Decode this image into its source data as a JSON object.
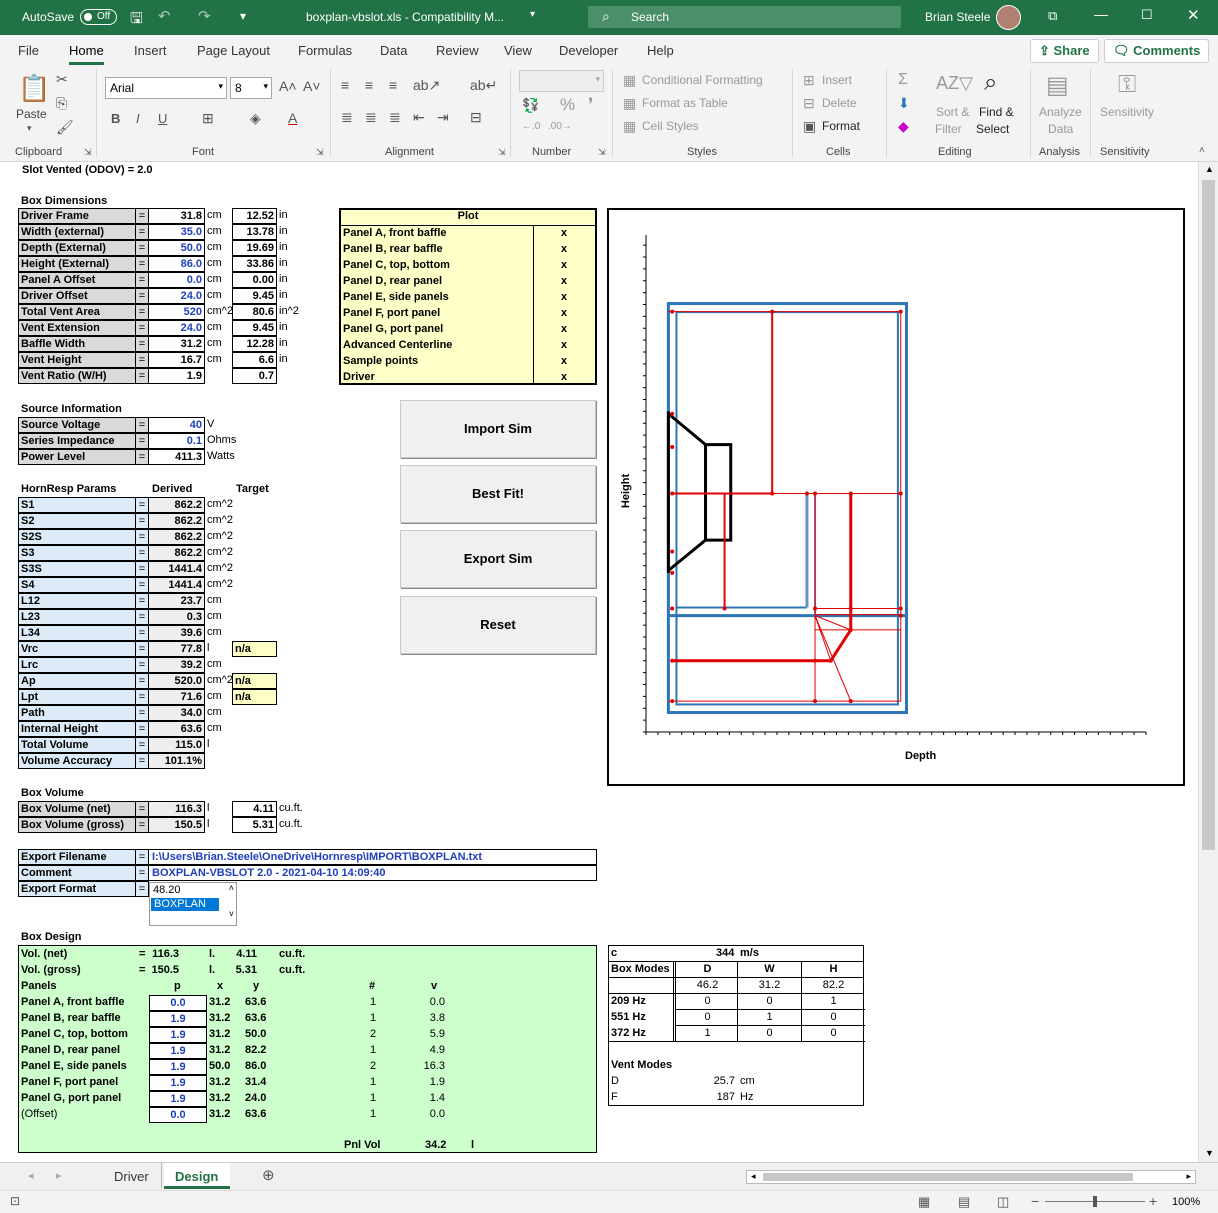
{
  "titlebar": {
    "autosave": "AutoSave",
    "toggle": "Off",
    "filename": "boxplan-vbslot.xls  -  Compatibility M...",
    "search": "Search",
    "user": "Brian Steele"
  },
  "tabs": [
    "File",
    "Home",
    "Insert",
    "Page Layout",
    "Formulas",
    "Data",
    "Review",
    "View",
    "Developer",
    "Help"
  ],
  "share": "Share",
  "comments": "Comments",
  "ribbon": {
    "paste": "Paste",
    "clipboard": "Clipboard",
    "font_name": "Arial",
    "font_size": "8",
    "font": "Font",
    "alignment": "Alignment",
    "number": "Number",
    "cond_format": "Conditional Formatting",
    "format_table": "Format as Table",
    "cell_styles": "Cell Styles",
    "styles": "Styles",
    "insert": "Insert",
    "delete": "Delete",
    "format": "Format",
    "cells": "Cells",
    "sort_filter_1": "Sort &",
    "sort_filter_2": "Filter",
    "find_select_1": "Find &",
    "find_select_2": "Select",
    "editing": "Editing",
    "analyze_1": "Analyze",
    "analyze_2": "Data",
    "analysis": "Analysis",
    "sensitivity": "Sensitivity",
    "sensitivity_grp": "Sensitivity"
  },
  "slot_vented": "Slot Vented (ODOV)   =  2.0",
  "box_dimensions": {
    "title": "Box Dimensions",
    "rows": [
      {
        "label": "Driver Frame",
        "v": "31.8",
        "u": "cm",
        "v2": "12.52",
        "u2": "in",
        "blue": false
      },
      {
        "label": "Width (external)",
        "v": "35.0",
        "u": "cm",
        "v2": "13.78",
        "u2": "in",
        "blue": true
      },
      {
        "label": "Depth (External)",
        "v": "50.0",
        "u": "cm",
        "v2": "19.69",
        "u2": "in",
        "blue": true
      },
      {
        "label": "Height (External)",
        "v": "86.0",
        "u": "cm",
        "v2": "33.86",
        "u2": "in",
        "blue": true
      },
      {
        "label": "Panel A Offset",
        "v": "0.0",
        "u": "cm",
        "v2": "0.00",
        "u2": "in",
        "blue": true
      },
      {
        "label": "Driver Offset",
        "v": "24.0",
        "u": "cm",
        "v2": "9.45",
        "u2": "in",
        "blue": true
      },
      {
        "label": "Total Vent Area",
        "v": "520",
        "u": "cm^2",
        "v2": "80.6",
        "u2": "in^2",
        "blue": true
      },
      {
        "label": "Vent Extension",
        "v": "24.0",
        "u": "cm",
        "v2": "9.45",
        "u2": "in",
        "blue": true
      },
      {
        "label": "Baffle Width",
        "v": "31.2",
        "u": "cm",
        "v2": "12.28",
        "u2": "in",
        "blue": false
      },
      {
        "label": "Vent Height",
        "v": "16.7",
        "u": "cm",
        "v2": "6.6",
        "u2": "in",
        "blue": false
      },
      {
        "label": "Vent Ratio (W/H)",
        "v": "1.9",
        "u": "",
        "v2": "0.7",
        "u2": "",
        "blue": false
      }
    ]
  },
  "plot": {
    "title": "Plot",
    "rows": [
      {
        "label": "Panel A, front baffle",
        "x": "x"
      },
      {
        "label": "Panel B, rear baffle",
        "x": "x"
      },
      {
        "label": "Panel C, top, bottom",
        "x": "x"
      },
      {
        "label": "Panel D, rear panel",
        "x": "x"
      },
      {
        "label": "Panel E, side panels",
        "x": "x"
      },
      {
        "label": "Panel F, port panel",
        "x": "x"
      },
      {
        "label": "Panel G, port panel",
        "x": "x"
      },
      {
        "label": "Advanced Centerline",
        "x": "x"
      },
      {
        "label": "Sample points",
        "x": "x"
      },
      {
        "label": "Driver",
        "x": "x"
      }
    ]
  },
  "source": {
    "title": "Source Information",
    "rows": [
      {
        "label": "Source Voltage",
        "v": "40",
        "u": "V"
      },
      {
        "label": "Series Impedance",
        "v": "0.1",
        "u": "Ohms"
      },
      {
        "label": "Power Level",
        "v": "411.3",
        "u": "Watts"
      }
    ]
  },
  "buttons": [
    "Import Sim",
    "Best Fit!",
    "Export Sim",
    "Reset"
  ],
  "hornresp": {
    "title": "HornResp Params",
    "derived": "Derived",
    "target": "Target",
    "rows": [
      {
        "label": "S1",
        "v": "862.2",
        "u": "cm^2",
        "t": ""
      },
      {
        "label": "S2",
        "v": "862.2",
        "u": "cm^2",
        "t": ""
      },
      {
        "label": "S2S",
        "v": "862.2",
        "u": "cm^2",
        "t": ""
      },
      {
        "label": "S3",
        "v": "862.2",
        "u": "cm^2",
        "t": ""
      },
      {
        "label": "S3S",
        "v": "1441.4",
        "u": "cm^2",
        "t": ""
      },
      {
        "label": "S4",
        "v": "1441.4",
        "u": "cm^2",
        "t": ""
      },
      {
        "label": "L12",
        "v": "23.7",
        "u": "cm",
        "t": ""
      },
      {
        "label": "L23",
        "v": "0.3",
        "u": "cm",
        "t": ""
      },
      {
        "label": "L34",
        "v": "39.6",
        "u": "cm",
        "t": ""
      },
      {
        "label": "Vrc",
        "v": "77.8",
        "u": "l",
        "t": "n/a"
      },
      {
        "label": "Lrc",
        "v": "39.2",
        "u": "cm",
        "t": ""
      },
      {
        "label": "Ap",
        "v": "520.0",
        "u": "cm^2",
        "t": "n/a"
      },
      {
        "label": "Lpt",
        "v": "71.6",
        "u": "cm",
        "t": "n/a"
      },
      {
        "label": "Path",
        "v": "34.0",
        "u": "cm",
        "t": ""
      },
      {
        "label": "Internal Height",
        "v": "63.6",
        "u": "cm",
        "t": ""
      },
      {
        "label": "Total Volume",
        "v": "115.0",
        "u": "l",
        "t": ""
      },
      {
        "label": "Volume Accuracy",
        "v": "101.1%",
        "u": "",
        "t": ""
      }
    ]
  },
  "box_volume": {
    "title": "Box Volume",
    "rows": [
      {
        "label": "Box Volume (net)",
        "v": "116.3",
        "u": "l",
        "v2": "4.11",
        "u2": "cu.ft."
      },
      {
        "label": "Box Volume (gross)",
        "v": "150.5",
        "u": "l",
        "v2": "5.31",
        "u2": "cu.ft."
      }
    ]
  },
  "export": {
    "filename_label": "Export Filename",
    "filename": "I:\\Users\\Brian.Steele\\OneDrive\\Hornresp\\IMPORT\\BOXPLAN.txt",
    "comment_label": "Comment",
    "comment": "BOXPLAN-VBSLOT 2.0 - 2021-04-10 14:09:40",
    "format_label": "Export Format",
    "options": [
      "48.20",
      "BOXPLAN"
    ]
  },
  "box_design": {
    "title": "Box Design",
    "vol_net": [
      "Vol. (net)",
      "=",
      "116.3",
      "l.",
      "4.11",
      "cu.ft."
    ],
    "vol_gross": [
      "Vol. (gross)",
      "=",
      "150.5",
      "l.",
      "5.31",
      "cu.ft."
    ],
    "headers": [
      "Panels",
      "p",
      "x",
      "y",
      "#",
      "v"
    ],
    "rows": [
      [
        "Panel A, front baffle",
        "0.0",
        "31.2",
        "63.6",
        "1",
        "0.0"
      ],
      [
        "Panel B, rear baffle",
        "1.9",
        "31.2",
        "63.6",
        "1",
        "3.8"
      ],
      [
        "Panel C, top, bottom",
        "1.9",
        "31.2",
        "50.0",
        "2",
        "5.9"
      ],
      [
        "Panel D, rear panel",
        "1.9",
        "31.2",
        "82.2",
        "1",
        "4.9"
      ],
      [
        "Panel E, side panels",
        "1.9",
        "50.0",
        "86.0",
        "2",
        "16.3"
      ],
      [
        "Panel F, port panel",
        "1.9",
        "31.2",
        "31.4",
        "1",
        "1.9"
      ],
      [
        "Panel G, port panel",
        "1.9",
        "31.2",
        "24.0",
        "1",
        "1.4"
      ],
      [
        "(Offset)",
        "0.0",
        "31.2",
        "63.6",
        "1",
        "0.0"
      ]
    ],
    "pnl_vol_label": "Pnl Vol",
    "pnl_vol": "34.2",
    "pnl_unit": "l"
  },
  "modes": {
    "c_label": "c",
    "c": "344",
    "c_unit": "m/s",
    "box_modes": "Box Modes",
    "cols": [
      "D",
      "W",
      "H"
    ],
    "dims": [
      "46.2",
      "31.2",
      "82.2"
    ],
    "rows": [
      [
        "209 Hz",
        "0",
        "0",
        "1"
      ],
      [
        "551 Hz",
        "0",
        "1",
        "0"
      ],
      [
        "372 Hz",
        "1",
        "0",
        "0"
      ]
    ],
    "vent_modes": "Vent Modes",
    "vent": [
      [
        "D",
        "25.7",
        "cm"
      ],
      [
        "F",
        "187",
        "Hz"
      ]
    ]
  },
  "chart": {
    "ylabel": "Height",
    "xlabel": "Depth"
  },
  "sheet_tabs": [
    "Driver",
    "Design"
  ],
  "status": {
    "zoom": "100%"
  },
  "colors": {
    "excel_green": "#217346",
    "panel_blue": "#2e75b6",
    "centerline_red": "#e00000"
  }
}
